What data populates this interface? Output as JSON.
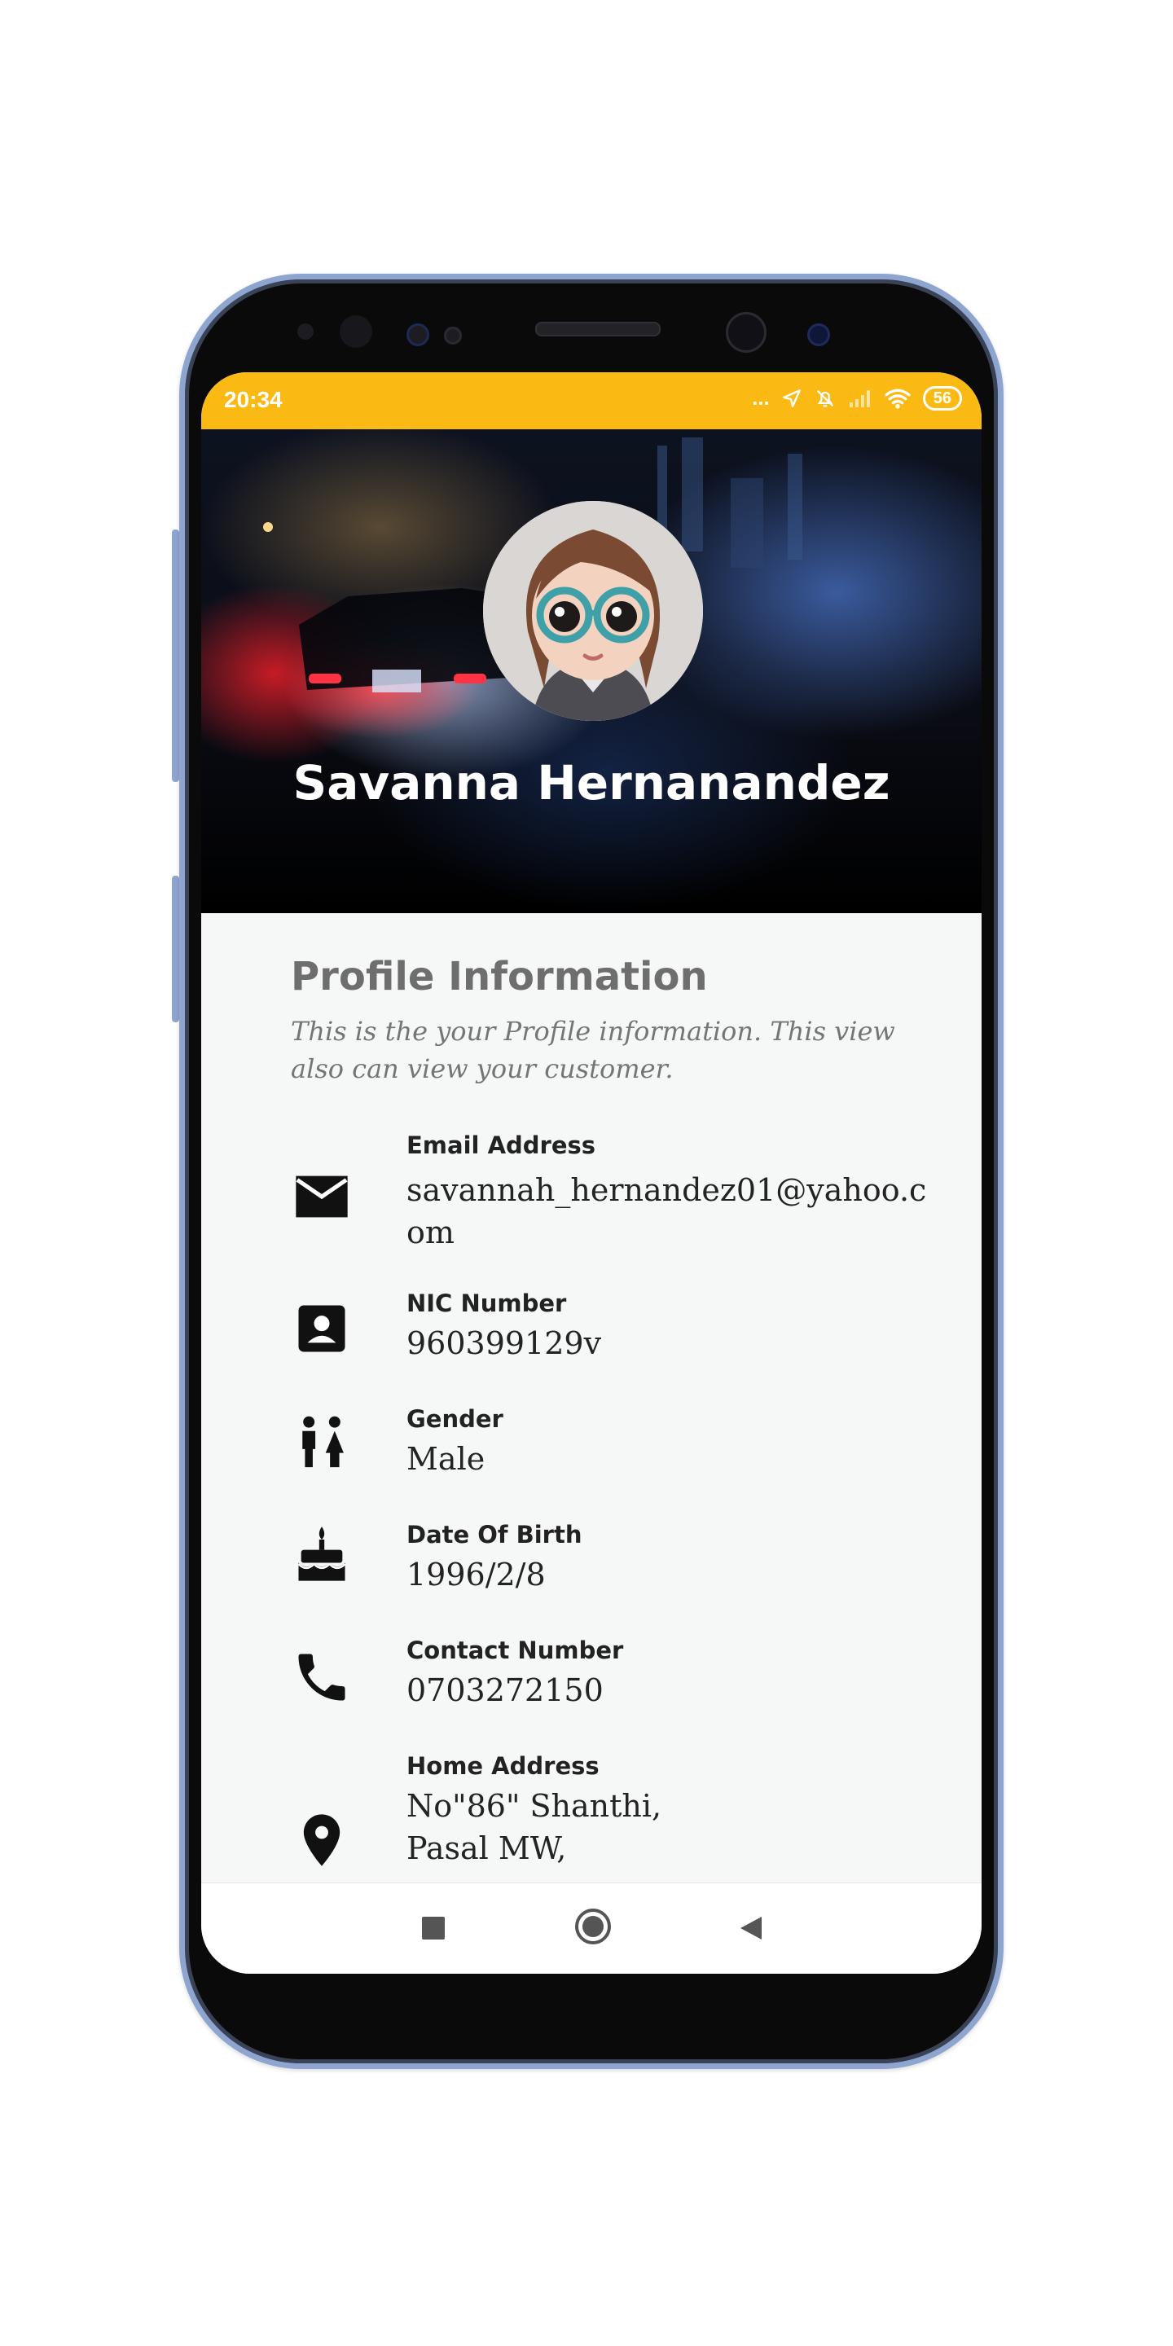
{
  "status_bar": {
    "time": "20:34",
    "dots": "...",
    "battery": "56"
  },
  "header": {
    "name": "Savanna Hernanandez"
  },
  "profile": {
    "title": "Profile Information",
    "subtitle": "This is the your Profile information. This view also can view your customer."
  },
  "fields": [
    {
      "icon": "email-icon",
      "label": "Email Address",
      "value": "savannah_hernandez01@yahoo.com"
    },
    {
      "icon": "contact-card-icon",
      "label": "NIC Number",
      "value": "960399129v"
    },
    {
      "icon": "gender-icon",
      "label": "Gender",
      "value": "Male"
    },
    {
      "icon": "cake-icon",
      "label": "Date Of Birth",
      "value": "1996/2/8"
    },
    {
      "icon": "phone-icon",
      "label": "Contact Number",
      "value": "0703272150"
    },
    {
      "icon": "location-pin-icon",
      "label": "Home Address",
      "value": "No\"86\" Shanthi, Pasal MW,",
      "value_line2": "Pasal MW,"
    }
  ],
  "theme": {
    "status_bar_color": "#fbb913",
    "content_bg": "#f6f7f7"
  }
}
